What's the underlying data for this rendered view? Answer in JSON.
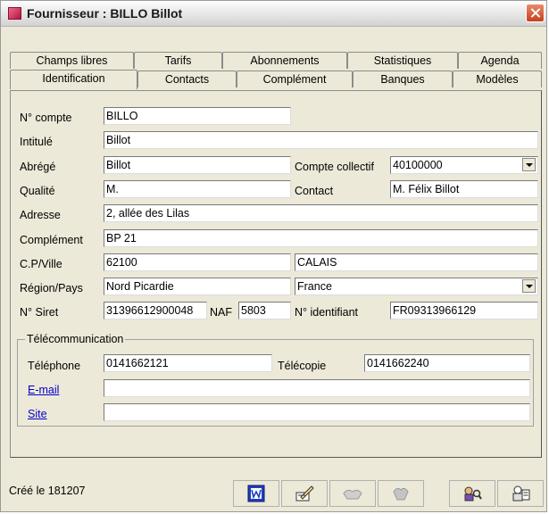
{
  "window": {
    "title": "Fournisseur : BILLO Billot"
  },
  "tabs_row1": [
    "Champs libres",
    "Tarifs",
    "Abonnements",
    "Statistiques",
    "Agenda"
  ],
  "tabs_row2": [
    "Identification",
    "Contacts",
    "Complément",
    "Banques",
    "Modèles"
  ],
  "active_tab": "Identification",
  "form": {
    "compte_label": "N° compte",
    "compte_value": "BILLO",
    "intitule_label": "Intitulé",
    "intitule_value": "Billot",
    "abrege_label": "Abrégé",
    "abrege_value": "Billot",
    "compte_collectif_label": "Compte collectif",
    "compte_collectif_value": "40100000",
    "qualite_label": "Qualité",
    "qualite_value": "M.",
    "contact_label": "Contact",
    "contact_value": "M. Félix Billot",
    "adresse_label": "Adresse",
    "adresse_value": "2, allée des Lilas",
    "complement_label": "Complément",
    "complement_value": "BP 21",
    "cpville_label": "C.P/Ville",
    "cp_value": "62100",
    "ville_value": "CALAIS",
    "regionpays_label": "Région/Pays",
    "region_value": "Nord Picardie",
    "pays_value": "France",
    "siret_label": "N° Siret",
    "siret_value": "31396612900048",
    "naf_label": "NAF",
    "naf_value": "5803",
    "identifiant_label": "N° identifiant",
    "identifiant_value": "FR09313966129"
  },
  "telecom": {
    "group_title": "Télécommunication",
    "telephone_label": "Téléphone",
    "telephone_value": "0141662121",
    "telecopie_label": "Télécopie",
    "telecopie_value": "0141662240",
    "email_label": "E-mail",
    "email_value": "",
    "site_label": "Site",
    "site_value": ""
  },
  "status": {
    "created": "Créé le 181207"
  },
  "toolbar": {
    "icons": [
      "word-icon",
      "edit-pencil-icon",
      "disabled-handshake-icon",
      "disabled-hands-icon",
      "search-people-icon",
      "person-reading-icon"
    ]
  },
  "colors": {
    "title_accent": "#c2185b",
    "link": "#0000cc",
    "background": "#ece9d8"
  }
}
